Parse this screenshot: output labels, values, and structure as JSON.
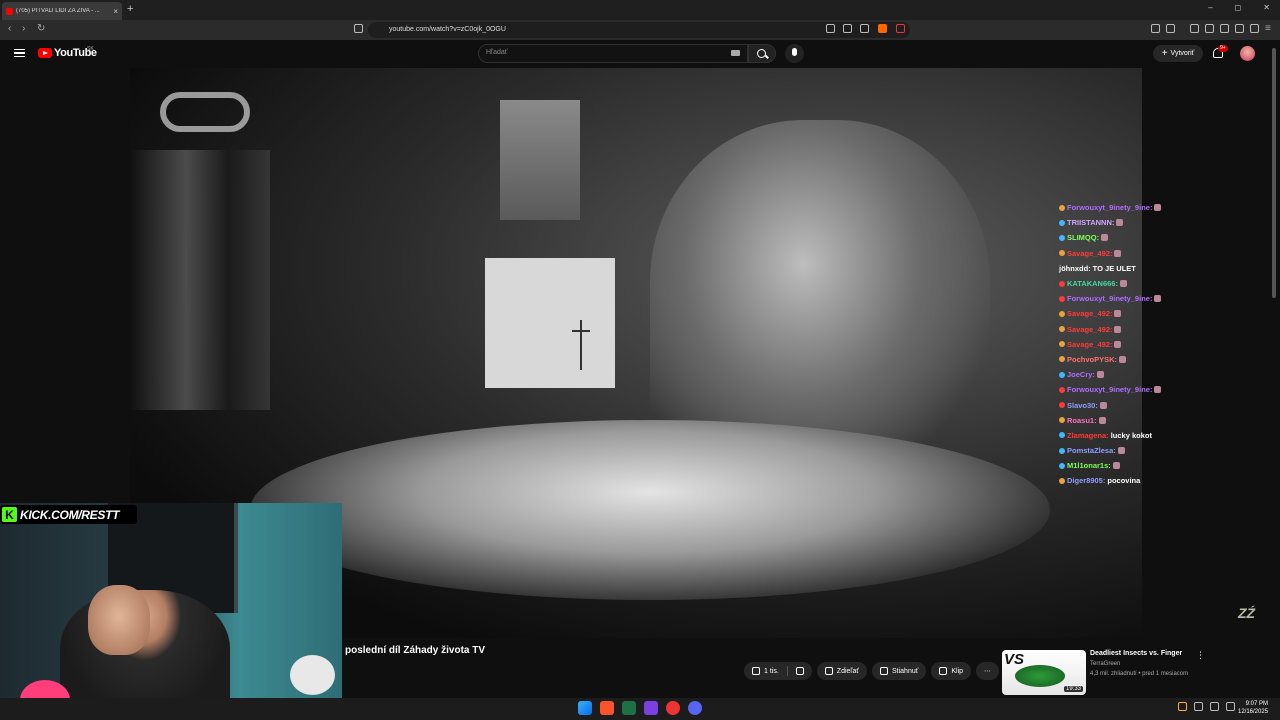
{
  "browser": {
    "tab_title": "(705) PITVALI LIDI ZA ŽIVA - ...",
    "url": "youtube.com/watch?v=zC0ojk_0OGU",
    "new_tab_symbol": "+",
    "close_symbol": "×"
  },
  "youtube": {
    "logo_text": "YouTube",
    "region": "SK",
    "search_placeholder": "Hľadať",
    "create_label": "Vytvoriť",
    "notifications_count": "9+"
  },
  "overlay": {
    "kick_text": "KICK.COM/RESTT",
    "watermark": "ZŹ"
  },
  "chat": [
    {
      "user": "Forwouxyt_9inety_9ine:",
      "color": "#b36bff",
      "badge": "#e8a33d",
      "text": ""
    },
    {
      "user": "TRIISTANNN:",
      "color": "#cfa6ff",
      "badge": "#3fb8ff",
      "text": ""
    },
    {
      "user": "SLIMQQ:",
      "color": "#7dff5a",
      "badge": "#3fb8ff",
      "text": ""
    },
    {
      "user": "Savage_492:",
      "color": "#ff3a3a",
      "badge": "#e8a33d",
      "text": ""
    },
    {
      "user": "jöhnxdd:",
      "color": "#ffffff",
      "badge": "",
      "text": "TO JE ULET"
    },
    {
      "user": "KATAKAN666:",
      "color": "#43d9a2",
      "badge": "#ff3a3a",
      "text": ""
    },
    {
      "user": "Forwouxyt_9inety_9ine:",
      "color": "#b36bff",
      "badge": "#ff3a3a",
      "text": ""
    },
    {
      "user": "Savage_492:",
      "color": "#ff3a3a",
      "badge": "#e8a33d",
      "text": ""
    },
    {
      "user": "Savage_492:",
      "color": "#ff3a3a",
      "badge": "#e8a33d",
      "text": ""
    },
    {
      "user": "Savage_492:",
      "color": "#ff3a3a",
      "badge": "#e8a33d",
      "text": ""
    },
    {
      "user": "PochvoPYSK:",
      "color": "#ff7070",
      "badge": "#e8a33d",
      "text": ""
    },
    {
      "user": "JoeCry:",
      "color": "#b36bff",
      "badge": "#3fb8ff",
      "text": ""
    },
    {
      "user": "Forwouxyt_9inety_9ine:",
      "color": "#b36bff",
      "badge": "#ff3a3a",
      "text": ""
    },
    {
      "user": "Slavo30:",
      "color": "#8f9dff",
      "badge": "#ff3a3a",
      "text": ""
    },
    {
      "user": "Roasu1:",
      "color": "#ff70c0",
      "badge": "#e8a33d",
      "text": ""
    },
    {
      "user": "Zlamagena:",
      "color": "#ff3a3a",
      "badge": "#3fb8ff",
      "text": "lucky kokot"
    },
    {
      "user": "PomstaZlesa:",
      "color": "#8f9dff",
      "badge": "#3fb8ff",
      "text": ""
    },
    {
      "user": "M1l1onar1s:",
      "color": "#7dff5a",
      "badge": "#3fb8ff",
      "text": ""
    },
    {
      "user": "Diger8905:",
      "color": "#8f9dff",
      "badge": "#e8a33d",
      "text": "pocovina"
    }
  ],
  "video": {
    "title": "poslední díl Záhady života TV"
  },
  "actions": {
    "like": "1 tis.",
    "share": "Zdieľať",
    "download": "Stiahnuť",
    "clip": "Klip",
    "more": "⋯"
  },
  "recommended": {
    "title": "Deadliest Insects vs. Finger",
    "channel": "TerraGreen",
    "meta": "4,3 mil. zhliadnutí • pred 1 mesiacom",
    "duration": "19:33",
    "thumb_text": "VS",
    "more": "⋮"
  },
  "taskbar": {
    "time": "9:07 PM",
    "date": "12/16/2025"
  }
}
